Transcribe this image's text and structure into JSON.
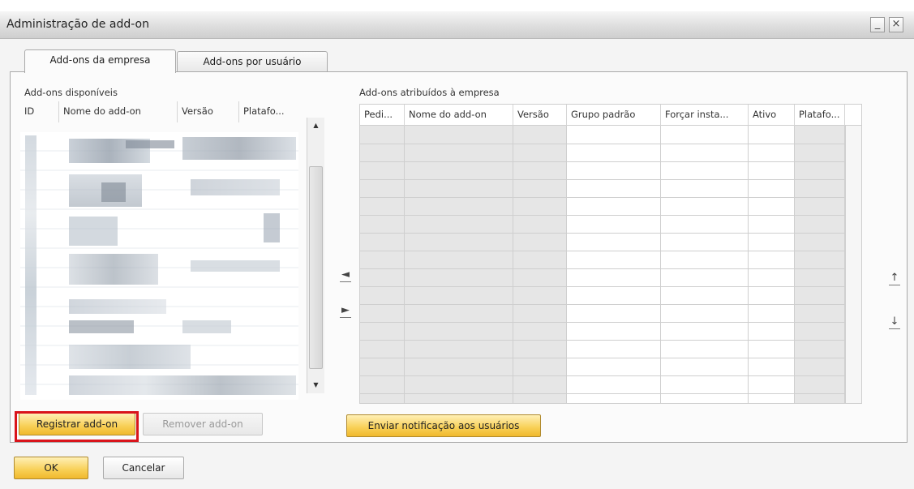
{
  "window": {
    "title": "Administração de add-on",
    "minimize_glyph": "_",
    "close_glyph": "×"
  },
  "tabs": [
    {
      "label": "Add-ons da empresa",
      "active": true
    },
    {
      "label": "Add-ons por usuário",
      "active": false
    }
  ],
  "available": {
    "label": "Add-ons disponíveis",
    "columns": [
      "ID",
      "Nome do add-on",
      "Versão",
      "Platafo..."
    ]
  },
  "assigned": {
    "label": "Add-ons atribuídos à empresa",
    "columns": [
      "Pedi...",
      "Nome do add-on",
      "Versão",
      "Grupo padrão",
      "Forçar insta...",
      "Ativo",
      "Platafo..."
    ]
  },
  "buttons": {
    "register": "Registrar add-on",
    "remove": "Remover add-on",
    "notify": "Enviar notificação aos usuários",
    "ok": "OK",
    "cancel": "Cancelar"
  },
  "icons": {
    "move_left": "◄",
    "move_right": "►",
    "move_up": "↑",
    "move_down": "↓",
    "scroll_up": "▲",
    "scroll_down": "▼"
  },
  "colors": {
    "accent_button": "#f8cf55",
    "highlight_border": "#d9141b"
  }
}
